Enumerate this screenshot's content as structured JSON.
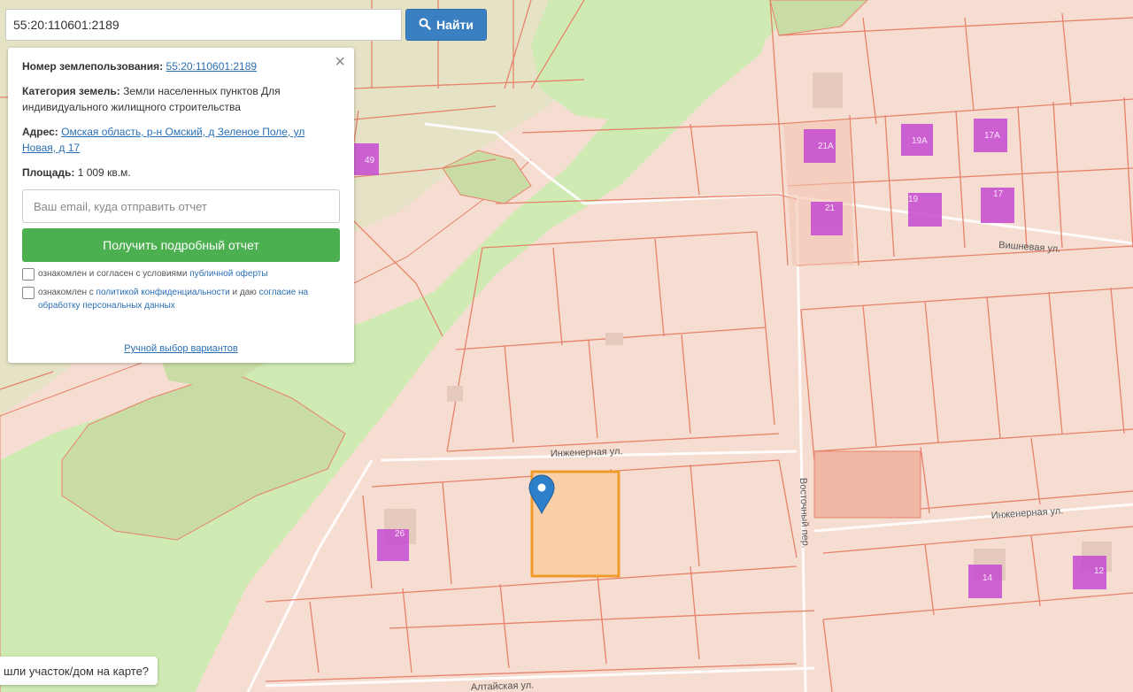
{
  "search": {
    "value": "55:20:110601:2189",
    "button_label": "Найти"
  },
  "info": {
    "cadastral_label": "Номер землепользования:",
    "cadastral_value": "55:20:110601:2189",
    "category_label": "Категория земель:",
    "category_value": "Земли населенных пунктов Для индивидуального жилищного строительства",
    "address_label": "Адрес:",
    "address_value": "Омская область, р-н Омский, д Зеленое Поле, ул Новая, д 17",
    "area_label": "Площадь:",
    "area_value": "1 009 кв.м.",
    "email_placeholder": "Ваш email, куда отправить отчет",
    "report_button": "Получить подробный отчет",
    "consent1_prefix": "ознакомлен и согласен с условиями",
    "consent1_link": "публичной оферты",
    "consent2_prefix": "ознакомлен с",
    "consent2_link": "политикой конфиденциальности",
    "consent2_middle": "и даю",
    "consent2_link2": "согласие на обработку персональных данных",
    "manual_link": "Ручной выбор вариантов",
    "close_symbol": "×"
  },
  "map": {
    "streets": [
      "Инженерная ул.",
      "Инженерная ул.",
      "Восточный пер.",
      "Алтайская ул.",
      "Вишневая ул."
    ],
    "house_numbers": [
      "49",
      "21А",
      "19А",
      "17А",
      "21",
      "19",
      "17",
      "26",
      "14",
      "12"
    ],
    "colors": {
      "background": "#f6ddd2",
      "parcel_line": "#e7826a",
      "green": "#cfeab3",
      "building": "#c74ed1",
      "selected_fill": "#f9cfa8",
      "selected_stroke": "#f19a2a",
      "marker": "#2e7fc9"
    }
  },
  "bottom_button": "шли участок/дом на карте?"
}
